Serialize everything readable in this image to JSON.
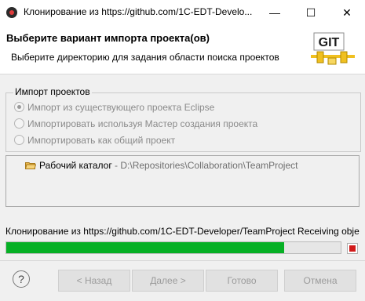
{
  "window": {
    "title": "Клонирование из https://github.com/1C-EDT-Develo...",
    "minimize_glyph": "—",
    "maximize_glyph": "☐",
    "close_glyph": "✕"
  },
  "header": {
    "title": "Выберите вариант импорта проекта(ов)",
    "subtitle": "Выберите директорию для задания области поиска проектов",
    "logo_text": "GIT"
  },
  "import_group": {
    "label": "Импорт проектов",
    "options": [
      {
        "label": "Импорт из существующего проекта Eclipse",
        "checked": true
      },
      {
        "label": "Импортировать используя Мастер создания проекта",
        "checked": false
      },
      {
        "label": "Импортировать как общий проект",
        "checked": false
      }
    ]
  },
  "tree": {
    "item_name": "Рабочий каталог",
    "item_separator": " - ",
    "item_path": "D:\\Repositories\\Collaboration\\TeamProject"
  },
  "progress": {
    "label": "Клонирование из https://github.com/1C-EDT-Developer/TeamProject Receiving obje",
    "fraction": 0.83
  },
  "footer": {
    "help_glyph": "?",
    "back_label": "< Назад",
    "next_label": "Далее >",
    "finish_label": "Готово",
    "cancel_label": "Отмена"
  },
  "colors": {
    "progress_fill": "#06b025",
    "stop_red": "#d11a1a",
    "logo_yellow": "#f0c020"
  }
}
